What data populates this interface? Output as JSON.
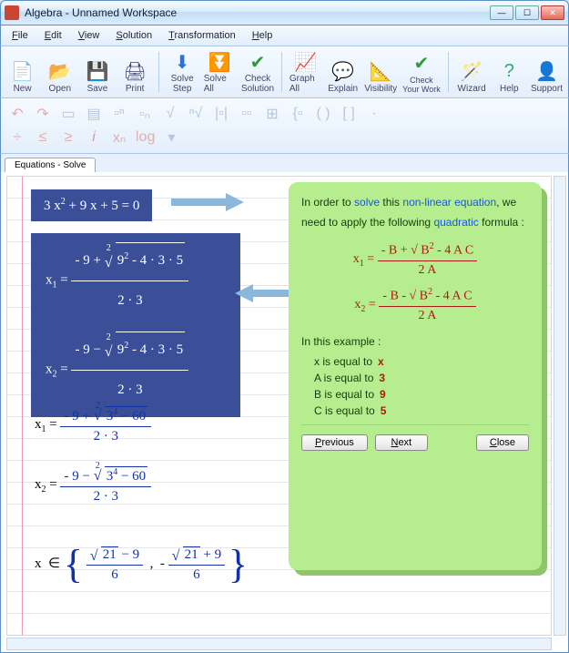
{
  "window": {
    "title": "Algebra - Unnamed Workspace"
  },
  "menu": {
    "file": "File",
    "edit": "Edit",
    "view": "View",
    "solution": "Solution",
    "transformation": "Transformation",
    "help": "Help"
  },
  "toolbar": {
    "new": "New",
    "open": "Open",
    "save": "Save",
    "print": "Print",
    "solvestep": "Solve\nStep",
    "solveall": "Solve All",
    "checksol": "Check\nSolution",
    "graphall": "Graph All",
    "explain": "Explain",
    "visibility": "Visibility",
    "checkwork": "Check\nYour Work",
    "wizard": "Wizard",
    "help": "Help",
    "support": "Support"
  },
  "tab": {
    "label": "Equations - Solve"
  },
  "equations": {
    "main": "3 x² + 9 x + 5 = 0",
    "x1_step1_num": "- 9 + √ 9² - 4 · 3 · 5",
    "x1_step1_den": "2 · 3",
    "x2_step1_num": "- 9 − √ 9² - 4 · 3 · 5",
    "x2_step1_den": "2 · 3",
    "x1_lbl": "x₁ =",
    "x2_lbl": "x₂ =",
    "x1_step2_num": "- 9 + √ 3⁴ − 60",
    "x1_step2_den": "2 · 3",
    "x2_step2_num": "- 9 − √ 3⁴ − 60",
    "x2_step2_den": "2 · 3",
    "set_pre": "x  ∈",
    "sol1_num": "√21 − 9",
    "sol1_den": "6",
    "sol2_num": "√21 + 9",
    "sol2_den": "6",
    "sep": " ,  - "
  },
  "panel": {
    "t1": "In order to ",
    "link1": "solve",
    "t2": " this ",
    "link2": "non-linear equation",
    "t3": ", we need to apply the following ",
    "link3": "quadratic",
    "t4": " formula :",
    "f1_lhs": "x₁ =",
    "f1_num": "- B + √ B² - 4 A C",
    "f1_den": "2 A",
    "f2_lhs": "x₂ =",
    "f2_num": "- B - √ B² - 4 A C",
    "f2_den": "2 A",
    "example": "In this example :",
    "rx": "x is equal to",
    "vx": "x",
    "ra": "A is equal to",
    "va": "3",
    "rb": "B is equal to",
    "vb": "9",
    "rc": "C is equal to",
    "vc": "5",
    "prev": "Previous",
    "next": "Next",
    "close": "Close"
  }
}
